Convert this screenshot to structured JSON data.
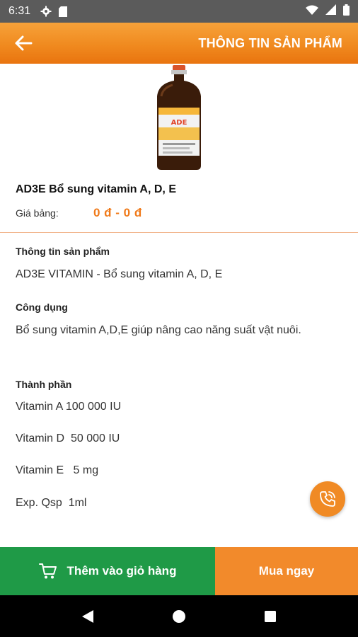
{
  "status_bar": {
    "time": "6:31",
    "icons": [
      "gear-icon",
      "sd-card-icon",
      "wifi-icon",
      "signal-icon",
      "battery-icon"
    ]
  },
  "app_bar": {
    "title": "THÔNG TIN SẢN PHẨM",
    "back_icon": "arrow-left-icon"
  },
  "product": {
    "name": "AD3E Bổ sung vitamin A, D, E",
    "price_label": "Giá bảng:",
    "price_value": "0 đ - 0 đ",
    "image_label": "ADE"
  },
  "sections": {
    "info": {
      "heading": "Thông tin sản phẩm",
      "text": "AD3E VITAMIN - Bổ sung vitamin A, D, E"
    },
    "usage": {
      "heading": "Công dụng",
      "text": "Bổ sung vitamin A,D,E giúp nâng cao năng suất vật nuôi."
    },
    "ingredients": {
      "heading": "Thành phần",
      "items": [
        "Vitamin A 100 000 IU",
        "Vitamin D  50 000 IU",
        "Vitamin E   5 mg",
        "Exp. Qsp  1ml"
      ]
    }
  },
  "actions": {
    "add_to_cart": "Thêm vào giỏ hàng",
    "buy_now": "Mua ngay"
  },
  "colors": {
    "accent_orange": "#f08a1f",
    "price_orange": "#f07a1a",
    "cart_green": "#1f9a47",
    "buy_orange": "#f28a2b"
  }
}
